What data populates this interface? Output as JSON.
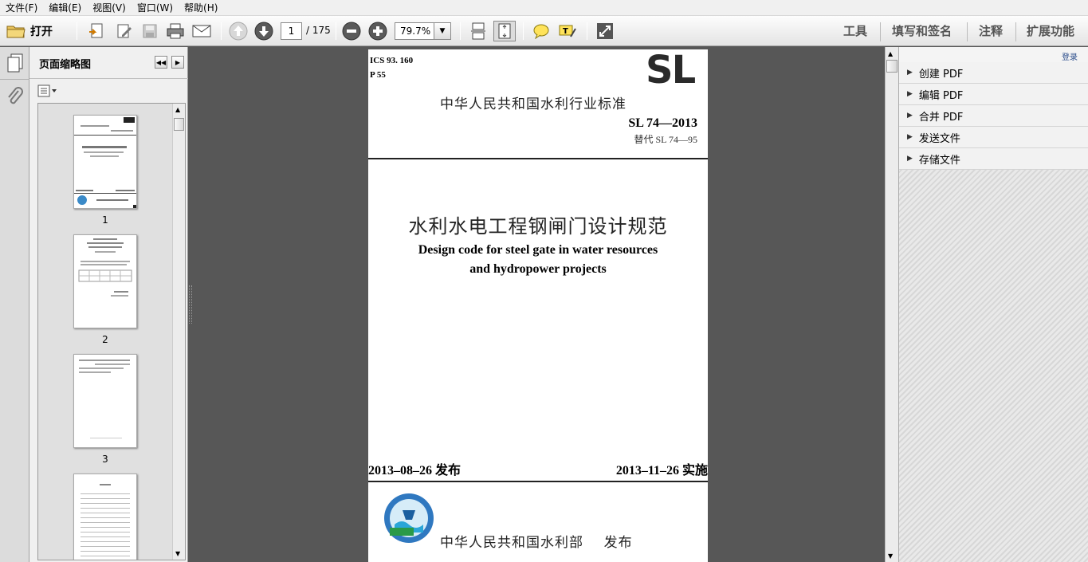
{
  "menu": [
    "文件(F)",
    "编辑(E)",
    "视图(V)",
    "窗口(W)",
    "帮助(H)"
  ],
  "toolbar": {
    "open_label": "打开",
    "page_current": "1",
    "page_total": "/ 175",
    "zoom": "79.7%",
    "right_tabs": [
      "工具",
      "填写和签名",
      "注释",
      "扩展功能"
    ]
  },
  "thumbnails": {
    "title": "页面缩略图",
    "pages": [
      {
        "label": "1"
      },
      {
        "label": "2"
      },
      {
        "label": "3"
      }
    ]
  },
  "document": {
    "ics": "ICS 93. 160",
    "pcode": "P 55",
    "logo": "SL",
    "org_title": "中华人民共和国水利行业标准",
    "std_no": "SL 74—2013",
    "replaces": "替代 SL 74—95",
    "title_cn": "水利水电工程钢闸门设计规范",
    "title_en_1": "Design code for steel gate in water resources",
    "title_en_2": "and hydropower projects",
    "issue_date": "2013–08–26 发布",
    "impl_date": "2013–11–26 实施",
    "publisher": "中华人民共和国水利部    发布"
  },
  "task_pane": {
    "login": "登录",
    "items": [
      "创建 PDF",
      "编辑 PDF",
      "合并 PDF",
      "发送文件",
      "存储文件"
    ]
  }
}
